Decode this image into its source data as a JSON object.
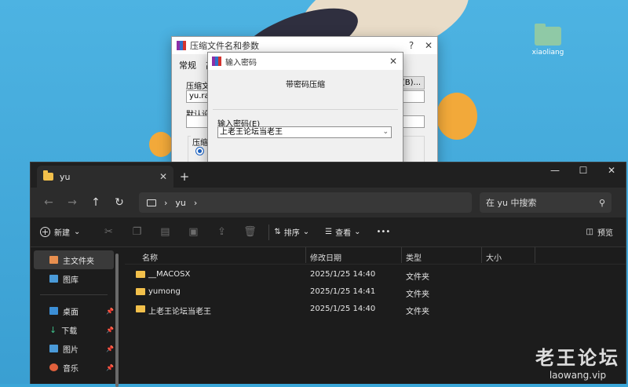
{
  "desktop": {
    "icon_label": "xiaoliang"
  },
  "rar_dialog": {
    "title": "压缩文件名和参数",
    "help": "?",
    "close": "✕",
    "tabs": [
      "常规",
      "高"
    ],
    "label_archive_name": "压缩文件",
    "archive_name_value": "yu.rar",
    "browse_label": "(B)...",
    "label_default": "默认设置",
    "label_format": "压缩文"
  },
  "pwd_dialog": {
    "title": "输入密码",
    "close": "✕",
    "heading": "带密码压缩",
    "label": "输入密码(E)",
    "value": "上老王论坛当老王"
  },
  "explorer": {
    "tab_title": "yu",
    "tab_close": "✕",
    "new_tab": "+",
    "window_buttons": {
      "minimize": "—",
      "maximize": "☐",
      "close": "✕"
    },
    "nav": {
      "back": "←",
      "forward": "→",
      "up": "↑",
      "refresh": "↻"
    },
    "address": {
      "sep1": "›",
      "crumb": "yu",
      "sep2": "›"
    },
    "search_placeholder": "在 yu 中搜索",
    "toolbar": {
      "new_label": "新建",
      "sort_label": "排序",
      "view_label": "查看",
      "more": "•••",
      "preview_label": "预览"
    },
    "sidebar": {
      "home": "主文件夹",
      "gallery": "图库",
      "desktop": "桌面",
      "downloads": "下载",
      "pictures": "图片",
      "music": "音乐"
    },
    "columns": {
      "name": "名称",
      "modified": "修改日期",
      "type": "类型",
      "size": "大小"
    },
    "files": [
      {
        "name": "__MACOSX",
        "modified": "2025/1/25 14:40",
        "type": "文件夹",
        "size": ""
      },
      {
        "name": "yumong",
        "modified": "2025/1/25 14:41",
        "type": "文件夹",
        "size": ""
      },
      {
        "name": "上老王论坛当老王",
        "modified": "2025/1/25 14:40",
        "type": "文件夹",
        "size": ""
      }
    ]
  },
  "watermark": {
    "title": "老王论坛",
    "url": "laowang.vip"
  }
}
